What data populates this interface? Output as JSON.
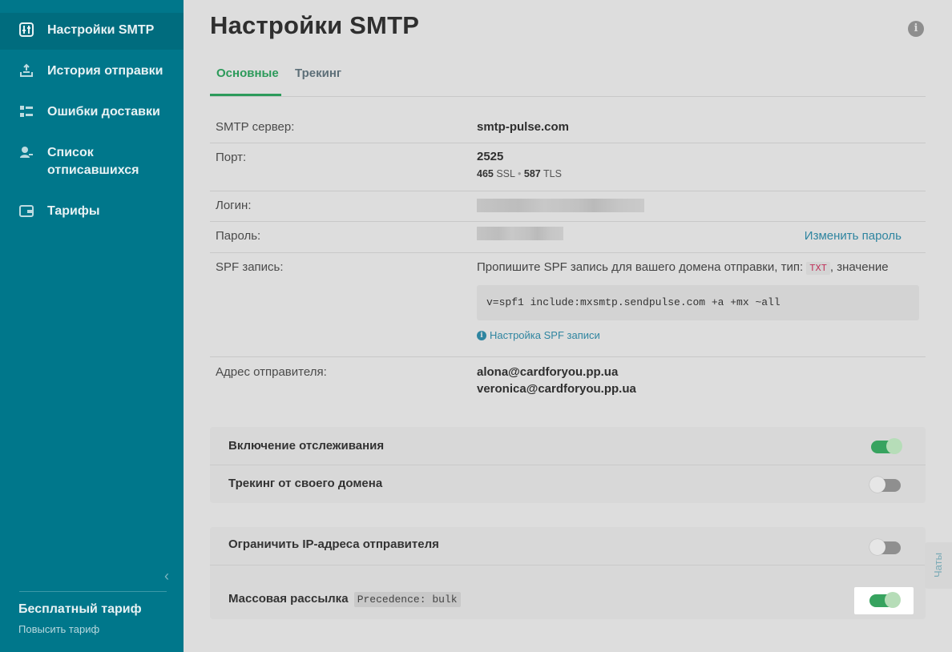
{
  "sidebar": {
    "items": [
      {
        "label": "Настройки SMTP",
        "icon": "sliders-icon",
        "active": true
      },
      {
        "label": "История отправки",
        "icon": "tray-upload-icon",
        "active": false
      },
      {
        "label": "Ошибки доставки",
        "icon": "error-list-icon",
        "active": false
      },
      {
        "label": "Список отписавшихся",
        "icon": "user-minus-icon",
        "active": false
      },
      {
        "label": "Тарифы",
        "icon": "wallet-icon",
        "active": false
      }
    ],
    "collapse_icon": "chevron-left-icon",
    "plan_name": "Бесплатный тариф",
    "plan_upgrade": "Повысить тариф"
  },
  "page": {
    "title": "Настройки SMTP",
    "info_icon": "i"
  },
  "tabs": [
    {
      "label": "Основные",
      "active": true
    },
    {
      "label": "Трекинг",
      "active": false
    }
  ],
  "settings": {
    "smtp_server": {
      "label": "SMTP сервер:",
      "value": "smtp-pulse.com"
    },
    "port": {
      "label": "Порт:",
      "value": "2525",
      "ssl_port": "465",
      "ssl_label": "SSL",
      "separator": "•",
      "tls_port": "587",
      "tls_label": "TLS"
    },
    "login": {
      "label": "Логин:",
      "value_blurred": true
    },
    "password": {
      "label": "Пароль:",
      "value_blurred": true,
      "change_link": "Изменить пароль"
    },
    "spf": {
      "label": "SPF запись:",
      "text_before": "Пропишите SPF запись для вашего домена отправки, тип:",
      "type": "TXT",
      "text_after": ", значение",
      "code": "v=spf1 include:mxsmtp.sendpulse.com +a +mx ~all",
      "help_link": "Настройка SPF записи"
    },
    "sender": {
      "label": "Адрес отправителя:",
      "addresses": [
        "alona@cardforyou.pp.ua",
        "veronica@cardforyou.pp.ua"
      ]
    }
  },
  "toggles": {
    "tracking": {
      "label": "Включение отслеживания",
      "on": true
    },
    "own_domain": {
      "label": "Трекинг от своего домена",
      "on": false
    },
    "restrict_ip": {
      "label": "Ограничить IP-адреса отправителя",
      "on": false
    },
    "bulk": {
      "label": "Массовая рассылка",
      "chip": "Precedence: bulk",
      "on": true
    }
  },
  "chats_tab": "Чаты",
  "colors": {
    "sidebar_bg": "#00778b",
    "accent_green": "#2c9a5a",
    "link_blue": "#2f85a0"
  }
}
